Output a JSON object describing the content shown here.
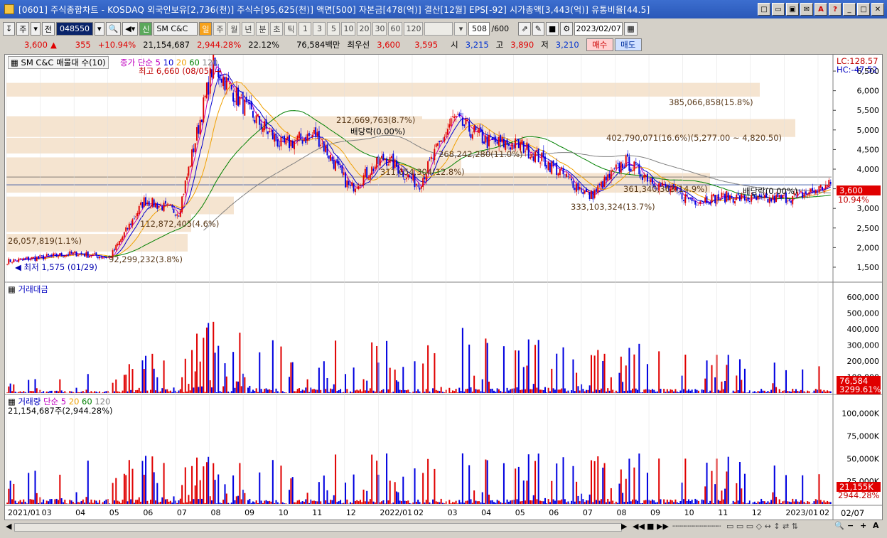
{
  "window": {
    "title": "[0601] 주식종합차트 - KOSDAQ 외국인보유[2,736(천)] 주식수[95,625(천)] 액면[500] 자본금[478(억)] 결산[12월] EPS[-92] 시가총액[3,443(억)] 유통비율[44.5]",
    "buttons": [
      "□",
      "▭",
      "▣",
      "✉",
      "A",
      "?",
      "_",
      "□",
      "✕"
    ]
  },
  "toolbar": {
    "main_label": "주",
    "prev_label": "전",
    "code": "048550",
    "name_prefix": "신",
    "stock_name": "SM C&C",
    "periods": [
      "일",
      "주",
      "월",
      "년",
      "분",
      "초",
      "틱"
    ],
    "intervals": [
      "1",
      "3",
      "5",
      "10",
      "20",
      "30",
      "60",
      "120"
    ],
    "count": "508",
    "count_max": "/600",
    "date": "2023/02/07"
  },
  "quote": {
    "price": "3,600",
    "arrow": "▲",
    "change": "355",
    "change_pct": "+10.94%",
    "volume": "21,154,687",
    "volume_pct": "2,944.28%",
    "turnover": "22.12%",
    "amount": "76,584백만",
    "best_label": "최우선",
    "ask": "3,600",
    "bid": "3,595",
    "open_label": "시",
    "open": "3,215",
    "high_label": "고",
    "high": "3,890",
    "low_label": "저",
    "low": "3,210",
    "buy_label": "매수",
    "sell_label": "매도"
  },
  "price_panel": {
    "legend_name": "SM C&C 매물대 수(10)",
    "ma_label": "종가 단순",
    "ma_periods": [
      "5",
      "10",
      "20",
      "60",
      "120"
    ],
    "high_note": "최고 6,660 (08/05)",
    "low_note": "최저 1,575 (01/29)",
    "lc": "LC:128.57",
    "hc": "HC:-47.52",
    "current_price": "3,600",
    "current_pct": "10.94%",
    "y_ticks": [
      "6,500",
      "6,000",
      "5,500",
      "5,000",
      "4,500",
      "4,000",
      "3,500",
      "3,000",
      "2,500",
      "2,000",
      "1,500"
    ],
    "volume_profile_labels": [
      "385,066,858(15.8%)",
      "212,669,763(8.7%)",
      "402,790,071(16.6%)(5,277.00 ~ 4,820.50)",
      "268,242,280(11.0%)",
      "311,654,304(12.8%)",
      "361,340,363(14.9%)",
      "112,872,405(4.6%)",
      "333,103,324(13.7%)",
      "26,057,819(1.1%)",
      "92,299,232(3.8%)"
    ],
    "dividend_notes": [
      "배당락(0.00%)",
      "배당락(0.00%)"
    ]
  },
  "amount_panel": {
    "title": "거래대금",
    "y_ticks": [
      "600,000",
      "500,000",
      "400,000",
      "300,000",
      "200,000",
      "100,000"
    ],
    "current_value": "76,584",
    "current_pct": "3299.61%"
  },
  "volume_panel": {
    "title": "거래량",
    "ma_label": "단순",
    "ma_periods": [
      "5",
      "20",
      "60",
      "120"
    ],
    "current_note": "21,154,687주(2,944.28%)",
    "y_ticks": [
      "100,000K",
      "75,000K",
      "50,000K",
      "25,000K"
    ],
    "current_value": "21,155K",
    "current_pct": "2944.28%"
  },
  "x_axis": [
    "2021/01",
    "03",
    "04",
    "05",
    "06",
    "07",
    "08",
    "09",
    "10",
    "11",
    "12",
    "2022/01",
    "02",
    "03",
    "04",
    "05",
    "06",
    "07",
    "08",
    "09",
    "10",
    "11",
    "12",
    "2023/01",
    "02"
  ],
  "x_axis_right": "02/07",
  "colors": {
    "up": "#e00000",
    "down": "#0000e0",
    "ma5": "#c000c0",
    "ma10": "#0000d0",
    "ma20": "#f0a000",
    "ma60": "#008000",
    "ma120": "#808080",
    "profile": "#f5e4d0"
  },
  "chart_data": {
    "type": "candlestick",
    "title": "SM C&C",
    "x_range": [
      "2021/01",
      "2023/02/07"
    ],
    "price_ylim": [
      1500,
      6500
    ],
    "price_path": [
      [
        "2021/01",
        1650
      ],
      [
        "2021/03",
        1750
      ],
      [
        "2021/04",
        1850
      ],
      [
        "2021/05",
        1750
      ],
      [
        "2021/06",
        3200
      ],
      [
        "2021/07",
        2900
      ],
      [
        "2021/08",
        6660
      ],
      [
        "2021/09",
        5500
      ],
      [
        "2021/10",
        4600
      ],
      [
        "2021/11",
        4900
      ],
      [
        "2021/12",
        3500
      ],
      [
        "2022/01",
        4300
      ],
      [
        "2022/02",
        3600
      ],
      [
        "2022/03",
        5300
      ],
      [
        "2022/04",
        4700
      ],
      [
        "2022/05",
        4600
      ],
      [
        "2022/06",
        4000
      ],
      [
        "2022/07",
        3300
      ],
      [
        "2022/08",
        4200
      ],
      [
        "2022/09",
        3600
      ],
      [
        "2022/10",
        3200
      ],
      [
        "2022/11",
        3300
      ],
      [
        "2022/12",
        3200
      ],
      [
        "2023/01",
        3300
      ],
      [
        "2023/02",
        3600
      ]
    ],
    "amount_ylim": [
      0,
      600000
    ],
    "volume_ylim": [
      0,
      100000
    ],
    "last": {
      "close": 3600,
      "open": 3215,
      "high": 3890,
      "low": 3210,
      "volume_k": 21155,
      "amount": 76584
    }
  }
}
